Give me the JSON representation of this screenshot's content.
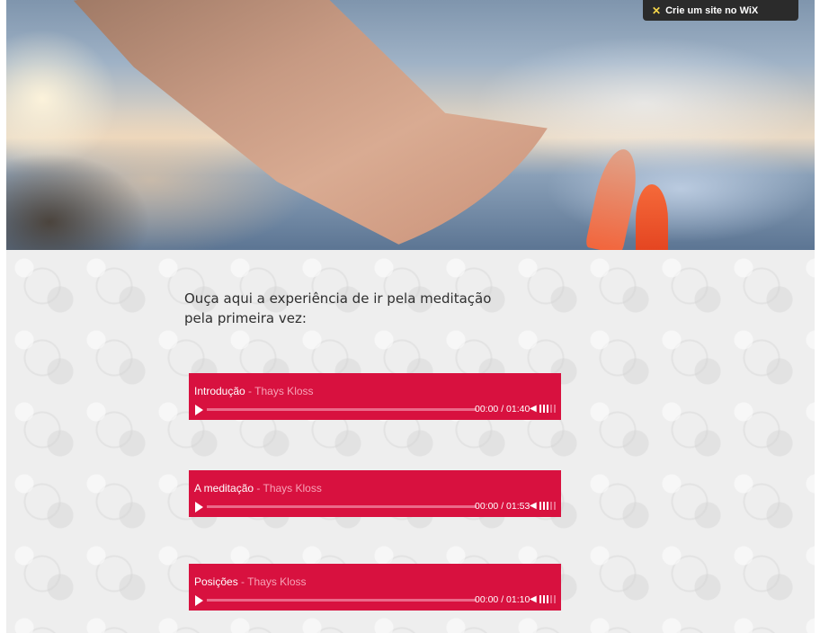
{
  "wix_banner": {
    "label": "Crie um site no WiX",
    "icon": "wix-icon"
  },
  "intro_text": "Ouça aqui a experiência de ir pela meditação pela primeira vez:",
  "players": [
    {
      "title": "Introdução",
      "separator": " - ",
      "artist": "Thays Kloss",
      "time": "00:00 / 01:40",
      "volume_level": 0.6
    },
    {
      "title": "A meditação",
      "separator": " - ",
      "artist": "Thays Kloss",
      "time": "00:00 / 01:53",
      "volume_level": 0.6
    },
    {
      "title": "Posições",
      "separator": " - ",
      "artist": "Thays Kloss",
      "time": "00:00 / 01:10",
      "volume_level": 0.6
    }
  ],
  "colors": {
    "player_bg": "#d8113f",
    "artist_text": "#f7a3b7",
    "banner_bg": "#2b2b2b"
  }
}
